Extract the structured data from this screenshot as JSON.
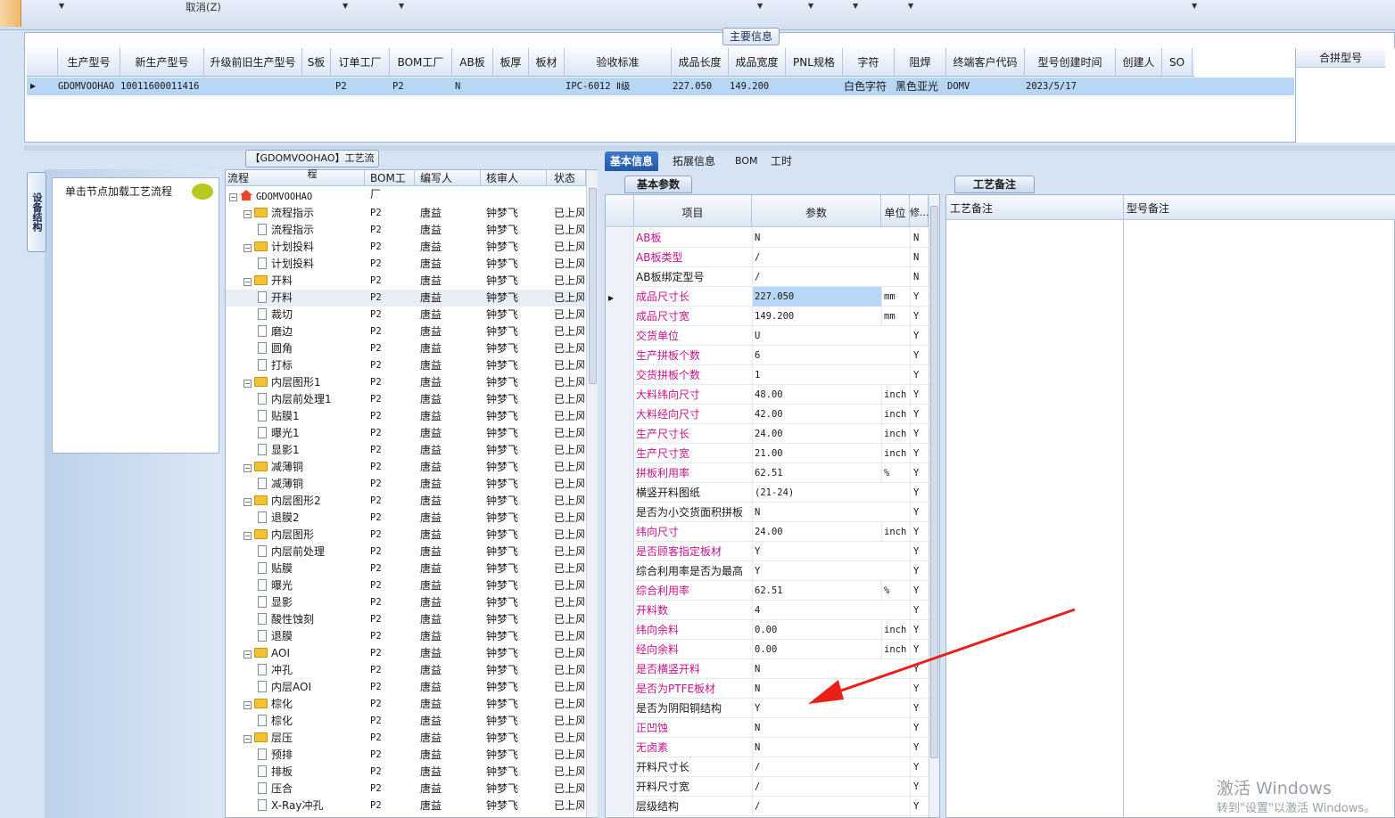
{
  "toolbar": {
    "cancel_label": "取消(Z)"
  },
  "main_info": {
    "tab_label": "主要信息",
    "columns": [
      "生产型号",
      "新生产型号",
      "升级前旧生产型号",
      "S板",
      "订单工厂",
      "BOM工厂",
      "AB板",
      "板厚",
      "板材",
      "验收标准",
      "成品长度",
      "成品宽度",
      "PNL规格",
      "字符",
      "阻焊",
      "终端客户代码",
      "型号创建时间",
      "创建人",
      "SO"
    ],
    "row": {
      "c0": "GDOMVOOHAO",
      "c1": "10011600011416",
      "c4": "P2",
      "c5": "P2",
      "c6": "N",
      "c9": "IPC-6012 Ⅱ级",
      "c10": "227.050",
      "c11": "149.200",
      "c13": "白色字符",
      "c14": "黑色亚光",
      "c15": "DOMV",
      "c16": "2023/5/17"
    },
    "merge_label": "合拼型号"
  },
  "left_panel": {
    "vertical_tab": "设备结构",
    "hint": "单击节点加载工艺流程"
  },
  "tree": {
    "title": "【GDOMVOOHAO】工艺流程",
    "columns": [
      "流程",
      "BOM工厂",
      "编写人",
      "核审人",
      "状态"
    ],
    "rows": [
      {
        "name": "GDOMVOOHAO",
        "bom": "",
        "author": "",
        "reviewer": "",
        "status": ""
      },
      {
        "name": "流程指示",
        "bom": "P2",
        "author": "唐益",
        "reviewer": "钟梦飞",
        "status": "已上风"
      },
      {
        "name": "流程指示",
        "bom": "P2",
        "author": "唐益",
        "reviewer": "钟梦飞",
        "status": "已上风"
      },
      {
        "name": "计划投料",
        "bom": "P2",
        "author": "唐益",
        "reviewer": "钟梦飞",
        "status": "已上风"
      },
      {
        "name": "计划投料",
        "bom": "P2",
        "author": "唐益",
        "reviewer": "钟梦飞",
        "status": "已上风"
      },
      {
        "name": "开料",
        "bom": "P2",
        "author": "唐益",
        "reviewer": "钟梦飞",
        "status": "已上风"
      },
      {
        "name": "开料",
        "bom": "P2",
        "author": "唐益",
        "reviewer": "钟梦飞",
        "status": "已上风"
      },
      {
        "name": "裁切",
        "bom": "P2",
        "author": "唐益",
        "reviewer": "钟梦飞",
        "status": "已上风"
      },
      {
        "name": "磨边",
        "bom": "P2",
        "author": "唐益",
        "reviewer": "钟梦飞",
        "status": "已上风"
      },
      {
        "name": "圆角",
        "bom": "P2",
        "author": "唐益",
        "reviewer": "钟梦飞",
        "status": "已上风"
      },
      {
        "name": "打标",
        "bom": "P2",
        "author": "唐益",
        "reviewer": "钟梦飞",
        "status": "已上风"
      },
      {
        "name": "内层图形1",
        "bom": "P2",
        "author": "唐益",
        "reviewer": "钟梦飞",
        "status": "已上风"
      },
      {
        "name": "内层前处理1",
        "bom": "P2",
        "author": "唐益",
        "reviewer": "钟梦飞",
        "status": "已上风"
      },
      {
        "name": "贴膜1",
        "bom": "P2",
        "author": "唐益",
        "reviewer": "钟梦飞",
        "status": "已上风"
      },
      {
        "name": "曝光1",
        "bom": "P2",
        "author": "唐益",
        "reviewer": "钟梦飞",
        "status": "已上风"
      },
      {
        "name": "显影1",
        "bom": "P2",
        "author": "唐益",
        "reviewer": "钟梦飞",
        "status": "已上风"
      },
      {
        "name": "减薄铜",
        "bom": "P2",
        "author": "唐益",
        "reviewer": "钟梦飞",
        "status": "已上风"
      },
      {
        "name": "减薄铜",
        "bom": "P2",
        "author": "唐益",
        "reviewer": "钟梦飞",
        "status": "已上风"
      },
      {
        "name": "内层图形2",
        "bom": "P2",
        "author": "唐益",
        "reviewer": "钟梦飞",
        "status": "已上风"
      },
      {
        "name": "退膜2",
        "bom": "P2",
        "author": "唐益",
        "reviewer": "钟梦飞",
        "status": "已上风"
      },
      {
        "name": "内层图形",
        "bom": "P2",
        "author": "唐益",
        "reviewer": "钟梦飞",
        "status": "已上风"
      },
      {
        "name": "内层前处理",
        "bom": "P2",
        "author": "唐益",
        "reviewer": "钟梦飞",
        "status": "已上风"
      },
      {
        "name": "贴膜",
        "bom": "P2",
        "author": "唐益",
        "reviewer": "钟梦飞",
        "status": "已上风"
      },
      {
        "name": "曝光",
        "bom": "P2",
        "author": "唐益",
        "reviewer": "钟梦飞",
        "status": "已上风"
      },
      {
        "name": "显影",
        "bom": "P2",
        "author": "唐益",
        "reviewer": "钟梦飞",
        "status": "已上风"
      },
      {
        "name": "酸性蚀刻",
        "bom": "P2",
        "author": "唐益",
        "reviewer": "钟梦飞",
        "status": "已上风"
      },
      {
        "name": "退膜",
        "bom": "P2",
        "author": "唐益",
        "reviewer": "钟梦飞",
        "status": "已上风"
      },
      {
        "name": "AOI",
        "bom": "P2",
        "author": "唐益",
        "reviewer": "钟梦飞",
        "status": "已上风"
      },
      {
        "name": "冲孔",
        "bom": "P2",
        "author": "唐益",
        "reviewer": "钟梦飞",
        "status": "已上风"
      },
      {
        "name": "内层AOI",
        "bom": "P2",
        "author": "唐益",
        "reviewer": "钟梦飞",
        "status": "已上风"
      },
      {
        "name": "棕化",
        "bom": "P2",
        "author": "唐益",
        "reviewer": "钟梦飞",
        "status": "已上风"
      },
      {
        "name": "棕化",
        "bom": "P2",
        "author": "唐益",
        "reviewer": "钟梦飞",
        "status": "已上风"
      },
      {
        "name": "层压",
        "bom": "P2",
        "author": "唐益",
        "reviewer": "钟梦飞",
        "status": "已上风"
      },
      {
        "name": "预排",
        "bom": "P2",
        "author": "唐益",
        "reviewer": "钟梦飞",
        "status": "已上风"
      },
      {
        "name": "排板",
        "bom": "P2",
        "author": "唐益",
        "reviewer": "钟梦飞",
        "status": "已上风"
      },
      {
        "name": "压合",
        "bom": "P2",
        "author": "唐益",
        "reviewer": "钟梦飞",
        "status": "已上风"
      },
      {
        "name": "X-Ray冲孔",
        "bom": "P2",
        "author": "唐益",
        "reviewer": "钟梦飞",
        "status": "已上风"
      }
    ]
  },
  "right_tabs": [
    "基本信息",
    "拓展信息",
    "BOM",
    "工时"
  ],
  "params": {
    "sub_tab": "基本参数",
    "columns": [
      "项目",
      "参数",
      "单位",
      "修..."
    ],
    "rows": [
      {
        "item": "AB板",
        "value": "N",
        "unit": "",
        "mod": "N",
        "red": true
      },
      {
        "item": "AB板类型",
        "value": "/",
        "unit": "",
        "mod": "N",
        "red": true
      },
      {
        "item": "AB板绑定型号",
        "value": "/",
        "unit": "",
        "mod": "N",
        "red": false
      },
      {
        "item": "成品尺寸长",
        "value": "227.050",
        "unit": "mm",
        "mod": "Y",
        "red": true
      },
      {
        "item": "成品尺寸宽",
        "value": "149.200",
        "unit": "mm",
        "mod": "Y",
        "red": true
      },
      {
        "item": "交货单位",
        "value": "U",
        "unit": "",
        "mod": "Y",
        "red": true
      },
      {
        "item": "生产拼板个数",
        "value": "6",
        "unit": "",
        "mod": "Y",
        "red": true
      },
      {
        "item": "交货拼板个数",
        "value": "1",
        "unit": "",
        "mod": "Y",
        "red": true
      },
      {
        "item": "大料纬向尺寸",
        "value": "48.00",
        "unit": "inch",
        "mod": "Y",
        "red": true
      },
      {
        "item": "大料经向尺寸",
        "value": "42.00",
        "unit": "inch",
        "mod": "Y",
        "red": true
      },
      {
        "item": "生产尺寸长",
        "value": "24.00",
        "unit": "inch",
        "mod": "Y",
        "red": true
      },
      {
        "item": "生产尺寸宽",
        "value": "21.00",
        "unit": "inch",
        "mod": "Y",
        "red": true
      },
      {
        "item": "拼板利用率",
        "value": "62.51",
        "unit": "%",
        "mod": "Y",
        "red": true
      },
      {
        "item": "横竖开料图纸",
        "value": "(21-24)",
        "unit": "",
        "mod": "Y",
        "red": false
      },
      {
        "item": "是否为小交货面积拼板",
        "value": "N",
        "unit": "",
        "mod": "Y",
        "red": false
      },
      {
        "item": "纬向尺寸",
        "value": "24.00",
        "unit": "inch",
        "mod": "Y",
        "red": true
      },
      {
        "item": "是否顾客指定板材",
        "value": "Y",
        "unit": "",
        "mod": "Y",
        "red": true
      },
      {
        "item": "综合利用率是否为最高",
        "value": "Y",
        "unit": "",
        "mod": "Y",
        "red": false
      },
      {
        "item": "综合利用率",
        "value": "62.51",
        "unit": "%",
        "mod": "Y",
        "red": true
      },
      {
        "item": "开料数",
        "value": "4",
        "unit": "",
        "mod": "Y",
        "red": true
      },
      {
        "item": "纬向余料",
        "value": "0.00",
        "unit": "inch",
        "mod": "Y",
        "red": true
      },
      {
        "item": "经向余料",
        "value": "0.00",
        "unit": "inch",
        "mod": "Y",
        "red": true
      },
      {
        "item": "是否横竖开料",
        "value": "N",
        "unit": "",
        "mod": "Y",
        "red": true
      },
      {
        "item": "是否为PTFE板材",
        "value": "N",
        "unit": "",
        "mod": "Y",
        "red": true
      },
      {
        "item": "是否为阴阳铜结构",
        "value": "Y",
        "unit": "",
        "mod": "Y",
        "red": false
      },
      {
        "item": "正凹蚀",
        "value": "N",
        "unit": "",
        "mod": "Y",
        "red": true
      },
      {
        "item": "无卤素",
        "value": "N",
        "unit": "",
        "mod": "Y",
        "red": true
      },
      {
        "item": "开料尺寸长",
        "value": "/",
        "unit": "",
        "mod": "Y",
        "red": false
      },
      {
        "item": "开料尺寸宽",
        "value": "/",
        "unit": "",
        "mod": "Y",
        "red": false
      },
      {
        "item": "层级结构",
        "value": "/",
        "unit": "",
        "mod": "Y",
        "red": false
      }
    ]
  },
  "remarks": {
    "tab_label": "工艺备注",
    "col1": "工艺备注",
    "col2": "型号备注"
  },
  "watermark": {
    "line1": "激活 Windows",
    "line2": "转到\"设置\"以激活 Windows。"
  },
  "colors": {
    "red_label": "#c0158a",
    "selection": "#b8d6f5",
    "annotation_arrow": "#e8201a"
  }
}
